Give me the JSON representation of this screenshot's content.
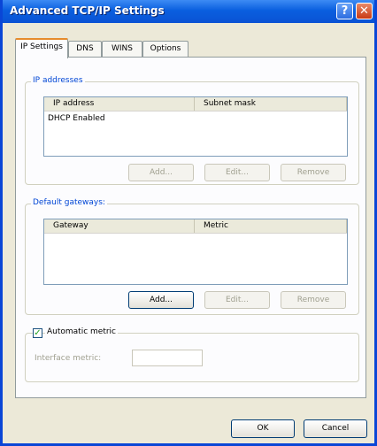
{
  "window": {
    "title": "Advanced TCP/IP Settings",
    "help_glyph": "?",
    "close_glyph": "✕"
  },
  "tabs": [
    {
      "label": "IP Settings",
      "active": true
    },
    {
      "label": "DNS",
      "active": false
    },
    {
      "label": "WINS",
      "active": false
    },
    {
      "label": "Options",
      "active": false
    }
  ],
  "ip_addresses": {
    "group_title": "IP addresses",
    "columns": [
      "IP address",
      "Subnet mask"
    ],
    "rows": [
      [
        "DHCP Enabled",
        ""
      ]
    ],
    "add_label": "Add...",
    "edit_label": "Edit...",
    "remove_label": "Remove"
  },
  "gateways": {
    "group_title": "Default gateways:",
    "columns": [
      "Gateway",
      "Metric"
    ],
    "add_label": "Add...",
    "edit_label": "Edit...",
    "remove_label": "Remove"
  },
  "metric": {
    "checkbox_label": "Automatic metric",
    "checked": true,
    "check_glyph": "✓",
    "interface_label": "Interface metric:",
    "interface_value": ""
  },
  "footer": {
    "ok_label": "OK",
    "cancel_label": "Cancel"
  },
  "colors": {
    "titlebar": "#0a5fdf",
    "group_title": "#0046d5",
    "dialog_bg": "#ece9d8"
  }
}
